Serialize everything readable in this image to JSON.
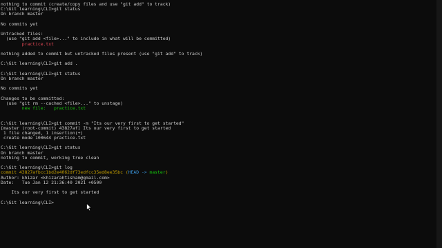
{
  "terminal": {
    "lines": [
      [
        {
          "t": "nothing to commit (create/copy files and use \"git add\" to track)",
          "c": "#cccccc"
        }
      ],
      [
        {
          "t": "C:\\Git learning\\CLI>git status",
          "c": "#cccccc"
        }
      ],
      [
        {
          "t": "On branch master",
          "c": "#cccccc"
        }
      ],
      [],
      [
        {
          "t": "No commits yet",
          "c": "#cccccc"
        }
      ],
      [],
      [
        {
          "t": "Untracked files:",
          "c": "#cccccc"
        }
      ],
      [
        {
          "t": "  (use \"git add <file>...\" to include in what will be committed)",
          "c": "#cccccc"
        }
      ],
      [
        {
          "t": "        practice.txt",
          "c": "#e74856"
        }
      ],
      [],
      [
        {
          "t": "nothing added to commit but untracked files present (use \"git add\" to track)",
          "c": "#cccccc"
        }
      ],
      [],
      [
        {
          "t": "C:\\Git learning\\CLI>git add .",
          "c": "#cccccc"
        }
      ],
      [],
      [
        {
          "t": "C:\\Git learning\\CLI>git status",
          "c": "#cccccc"
        }
      ],
      [
        {
          "t": "On branch master",
          "c": "#cccccc"
        }
      ],
      [],
      [
        {
          "t": "No commits yet",
          "c": "#cccccc"
        }
      ],
      [],
      [
        {
          "t": "Changes to be committed:",
          "c": "#cccccc"
        }
      ],
      [
        {
          "t": "  (use \"git rm --cached <file>...\" to unstage)",
          "c": "#cccccc"
        }
      ],
      [
        {
          "t": "        new file:   practice.txt",
          "c": "#16c60c"
        }
      ],
      [],
      [],
      [
        {
          "t": "C:\\Git learning\\CLI>git commit -m \"Its our very first to get started\"",
          "c": "#cccccc"
        }
      ],
      [
        {
          "t": "[master (root-commit) 43827af] Its our very first to get started",
          "c": "#cccccc"
        }
      ],
      [
        {
          "t": " 1 file changed, 1 insertion(+)",
          "c": "#cccccc"
        }
      ],
      [
        {
          "t": " create mode 100644 practice.txt",
          "c": "#cccccc"
        }
      ],
      [],
      [
        {
          "t": "C:\\Git learning\\CLI>git status",
          "c": "#cccccc"
        }
      ],
      [
        {
          "t": "On branch master",
          "c": "#cccccc"
        }
      ],
      [
        {
          "t": "nothing to commit, working tree clean",
          "c": "#cccccc"
        }
      ],
      [],
      [
        {
          "t": "C:\\Git learning\\CLI>git log",
          "c": "#cccccc"
        }
      ],
      [
        {
          "t": "commit 43827afbcc1bd2e4062df73edfcc35ed8ee35bc",
          "c": "#c19c00"
        },
        {
          "t": " (",
          "c": "#c19c00"
        },
        {
          "t": "HEAD -> ",
          "c": "#3a96dd"
        },
        {
          "t": "master",
          "c": "#16c60c"
        },
        {
          "t": ")",
          "c": "#c19c00"
        }
      ],
      [
        {
          "t": "Author: khizar <khizarahtisham@gmail.com>",
          "c": "#cccccc"
        }
      ],
      [
        {
          "t": "Date:   Tue Jan 12 21:36:40 2021 +0500",
          "c": "#cccccc"
        }
      ],
      [],
      [
        {
          "t": "    Its our very first to get started",
          "c": "#cccccc"
        }
      ],
      [],
      [
        {
          "t": "C:\\Git learning\\CLI>",
          "c": "#cccccc"
        }
      ]
    ]
  },
  "icons": {
    "mouse_pointer": "arrow-cursor-icon"
  },
  "colors": {
    "background": "#0c0c0c",
    "text": "#cccccc",
    "red": "#e74856",
    "green": "#16c60c",
    "yellow": "#c19c00",
    "cyan": "#3a96dd"
  }
}
